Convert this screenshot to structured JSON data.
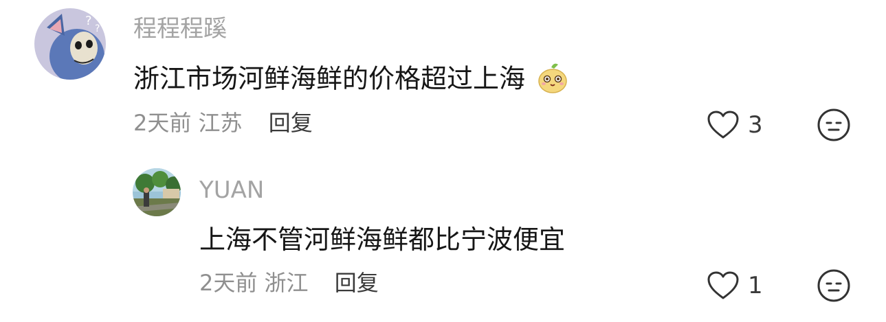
{
  "comments": [
    {
      "username": "程程程蹊",
      "text": "浙江市场河鲜海鲜的价格超过上海",
      "time": "2天前",
      "location": "江苏",
      "reply_label": "回复",
      "like_count": "3",
      "avatar_icon": "cartoon-cat-avatar",
      "inline_emoji": "shy-bean-emoji"
    },
    {
      "username": "YUAN",
      "text": "上海不管河鲜海鲜都比宁波便宜",
      "time": "2天前",
      "location": "浙江",
      "reply_label": "回复",
      "like_count": "1",
      "avatar_icon": "outdoor-photo-avatar"
    }
  ],
  "icons": {
    "like": "heart-outline-icon",
    "emoji_reaction": "neutral-face-icon"
  },
  "colors": {
    "username": "#a3a3a3",
    "content": "#161616",
    "meta": "#8f8f8f",
    "reply": "#3a3a3a"
  }
}
